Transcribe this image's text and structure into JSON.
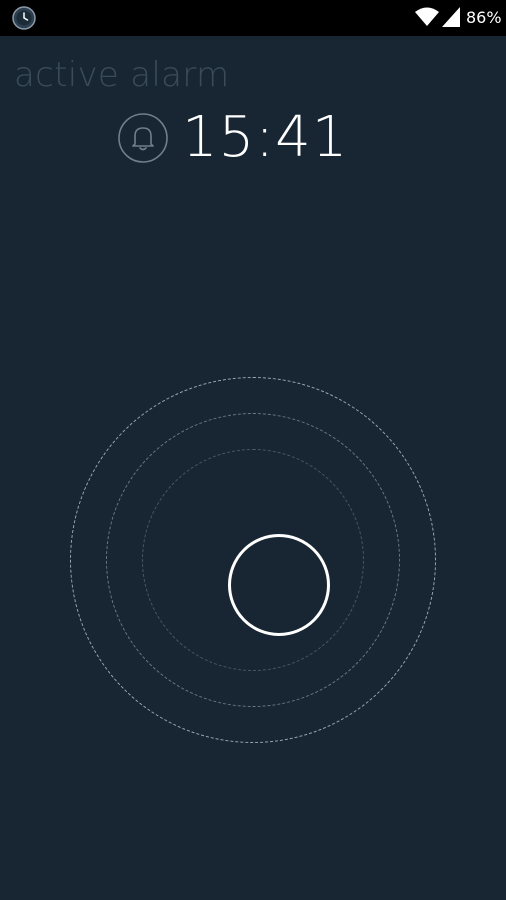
{
  "status_bar": {
    "app_icon": "alarm-clock-icon",
    "wifi_icon": "wifi-icon",
    "signal_icon": "cell-signal-icon",
    "battery": "86%"
  },
  "screen": {
    "title": "active alarm",
    "bell_icon": "bell-icon",
    "time": "15:41"
  },
  "controls": {
    "dismiss_handle_icon": "circle-handle"
  },
  "colors": {
    "background": "#182633",
    "status_bar": "#000000",
    "title": "#3a4c5b",
    "time": "#ffffff",
    "ring": "#ffffff"
  }
}
